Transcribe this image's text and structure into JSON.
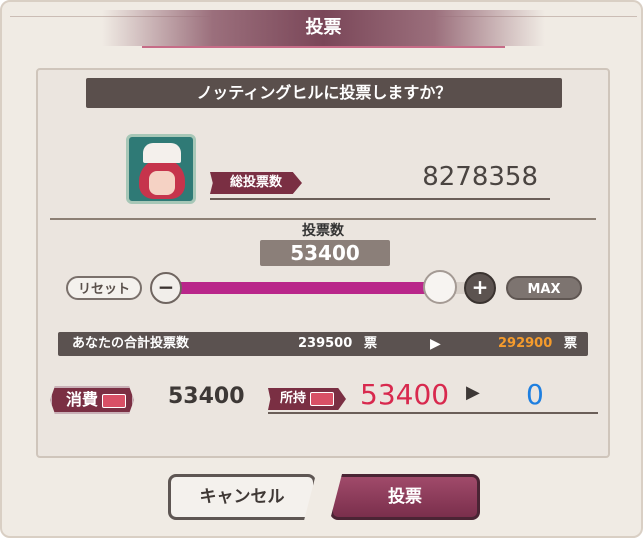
{
  "dialog": {
    "title": "投票"
  },
  "question": "ノッティングヒルに投票しますか？",
  "character": {
    "avatar_icon": "character-portrait-icon"
  },
  "total_votes": {
    "label": "総投票数",
    "value": "8278358"
  },
  "vote_count": {
    "label": "投票数",
    "value": "53400"
  },
  "slider": {
    "reset_label": "リセット",
    "minus_symbol": "−",
    "plus_symbol": "+",
    "max_label": "MAX",
    "level": 0.87
  },
  "your_total": {
    "label": "あなたの合計投票数",
    "current": "239500",
    "unit": "票",
    "next": "292900",
    "arrow": "▶"
  },
  "consume": {
    "label": "消費",
    "value": "53400"
  },
  "owned": {
    "label": "所持",
    "current": "53400",
    "arrow": "▶",
    "after": "0"
  },
  "buttons": {
    "cancel": "キャンセル",
    "vote": "投票"
  },
  "colors": {
    "accent": "#7a2f43",
    "slider_fill": "#b9268a",
    "next_total": "#f59b2c",
    "owned_current": "#d8294e",
    "owned_after": "#1e7fe0"
  }
}
